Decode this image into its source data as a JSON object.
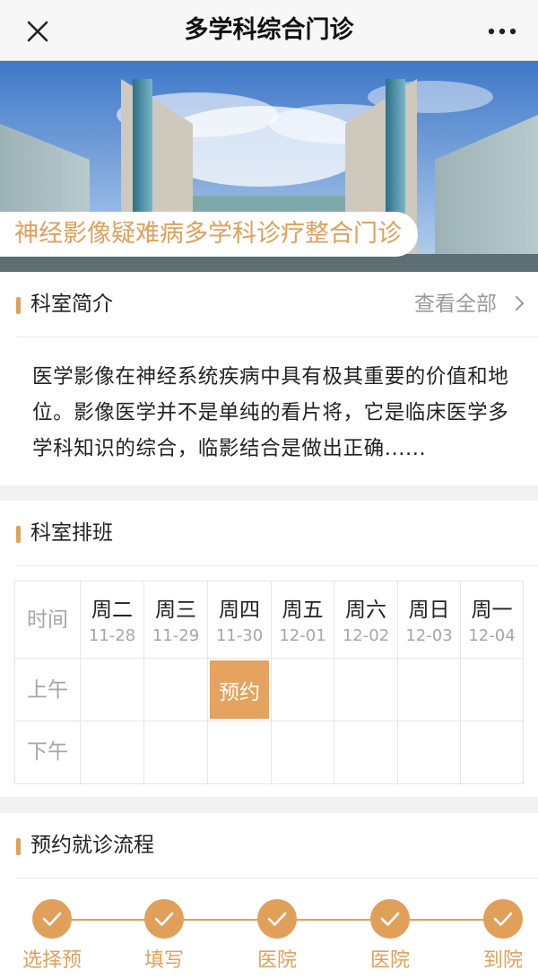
{
  "navbar": {
    "close_icon": "close-icon",
    "title": "多学科综合门诊",
    "more_icon": "more-icon"
  },
  "banner": {
    "caption": "神经影像疑难病多学科诊疗整合门诊"
  },
  "intro": {
    "title": "科室简介",
    "more_label": "查看全部",
    "text": "医学影像在神经系统疾病中具有极其重要的价值和地位。影像医学并不是单纯的看片将，它是临床医学多学科知识的综合，临影结合是做出正确......"
  },
  "schedule": {
    "title": "科室排班",
    "time_header": "时间",
    "days": [
      {
        "name": "周二",
        "date": "11-28"
      },
      {
        "name": "周三",
        "date": "11-29"
      },
      {
        "name": "周四",
        "date": "11-30"
      },
      {
        "name": "周五",
        "date": "12-01"
      },
      {
        "name": "周六",
        "date": "12-02"
      },
      {
        "name": "周日",
        "date": "12-03"
      },
      {
        "name": "周一",
        "date": "12-04"
      }
    ],
    "rows": [
      {
        "label": "上午",
        "slots": [
          "",
          "",
          "预约",
          "",
          "",
          "",
          ""
        ]
      },
      {
        "label": "下午",
        "slots": [
          "",
          "",
          "",
          "",
          "",
          "",
          ""
        ]
      }
    ],
    "accent_color": "#e0a05a"
  },
  "process": {
    "title": "预约就诊流程",
    "steps": [
      {
        "label": "选择预",
        "icon": "check-icon"
      },
      {
        "label": "填写",
        "icon": "check-icon"
      },
      {
        "label": "医院",
        "icon": "check-icon"
      },
      {
        "label": "医院",
        "icon": "check-icon"
      },
      {
        "label": "到院",
        "icon": "check-icon"
      }
    ]
  }
}
